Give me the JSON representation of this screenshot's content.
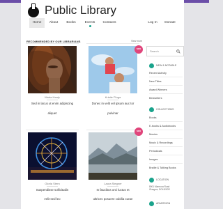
{
  "site": {
    "title": "Public Library"
  },
  "nav": {
    "items": [
      {
        "label": "Home",
        "active": true
      },
      {
        "label": "About"
      },
      {
        "label": "Books"
      },
      {
        "label": "Events"
      },
      {
        "label": "Contacts"
      },
      {
        "label": "Log In"
      },
      {
        "label": "Donate"
      }
    ]
  },
  "section": {
    "title": "RECOMMENDED BY OUR LIBRARIANS",
    "view_more": "View more"
  },
  "cards": [
    {
      "author": "Marta Healy",
      "desc1": "Sed in lacus ut enim adipiscing",
      "desc2": "aliquet"
    },
    {
      "author": "Kristie Pluga",
      "desc1": "Donec in velit vel ipsum auc tor",
      "desc2": "pulvinar",
      "badge": "NEW"
    },
    {
      "author": "Gloria Stern",
      "desc1": "Suspendisse sollicitudin",
      "desc2": "velit sed leo"
    },
    {
      "author": "Laura Stegner",
      "desc1": "In faucibus orci luctus et",
      "desc2": "ultrices posuere cubilia curae",
      "badge": "NEW"
    }
  ],
  "sidebar": {
    "search_placeholder": "Search",
    "new_notable": {
      "heading": "NEW & NOTABLE",
      "items": [
        "Recent Activity",
        "New Titles",
        "Award Winners",
        "Bestsellers"
      ]
    },
    "collections": {
      "heading": "COLLECTIONS",
      "items": [
        "Books",
        "E-books & Audiobooks",
        "Movies",
        "Music & Recordings",
        "Periodicals",
        "Images",
        "Braille & Talking Books"
      ]
    },
    "location": {
      "heading": "LOCATION",
      "line1": "8901 Marmora Road",
      "line2": "Glasgow, DO4 89GR"
    },
    "admission": {
      "heading": "ADMISSION"
    }
  },
  "colors": {
    "accent": "#1aa38c",
    "badge": "#e0457b",
    "topbar": "#6b4ea8"
  }
}
